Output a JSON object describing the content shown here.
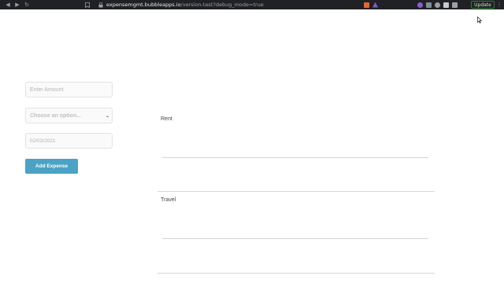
{
  "browser": {
    "url_host": "expensemgmt.bubbleapps.io",
    "url_path": "/version-test?debug_mode=true",
    "update_label": "Update",
    "back_icon": "back-icon",
    "forward_icon": "forward-icon",
    "reload_icon": "reload-icon",
    "menu_icon": "kebab-menu-icon"
  },
  "form": {
    "amount_placeholder": "Enter Amount",
    "category_value": "Choose an option...",
    "date_value": "02/03/2021",
    "add_button_label": "Add Expense"
  },
  "categories": [
    {
      "label": "Rent"
    },
    {
      "label": "Travel"
    }
  ],
  "colors": {
    "accent": "#4aa3c4",
    "chrome_bg": "#202124"
  }
}
